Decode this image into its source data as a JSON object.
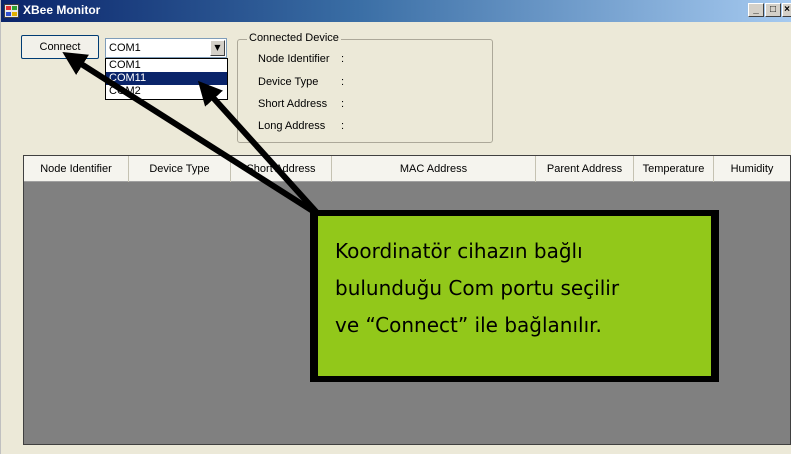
{
  "window": {
    "title": "XBee Monitor"
  },
  "window_controls": {
    "minimize": "_",
    "maximize": "□",
    "close": "×"
  },
  "connect_button": {
    "label": "Connect"
  },
  "port_combo": {
    "selected": "COM1",
    "options": [
      "COM1",
      "COM11",
      "COM2"
    ],
    "highlighted": "COM11"
  },
  "connected_device": {
    "legend": "Connected Device",
    "fields": [
      {
        "label": "Node Identifier",
        "value": ":"
      },
      {
        "label": "Device Type",
        "value": ":"
      },
      {
        "label": "Short Address",
        "value": ":"
      },
      {
        "label": "Long Address",
        "value": ":"
      }
    ]
  },
  "grid": {
    "columns": [
      "Node Identifier",
      "Device Type",
      "Short Address",
      "MAC Address",
      "Parent Address",
      "Temperature",
      "Humidity"
    ],
    "rows": []
  },
  "callout": {
    "lines": [
      "Koordinatör cihazın bağlı",
      "bulunduğu Com portu seçilir",
      "ve “Connect” ile bağlanılır."
    ],
    "fill_color": "#92c81a",
    "border_color": "#000000"
  }
}
